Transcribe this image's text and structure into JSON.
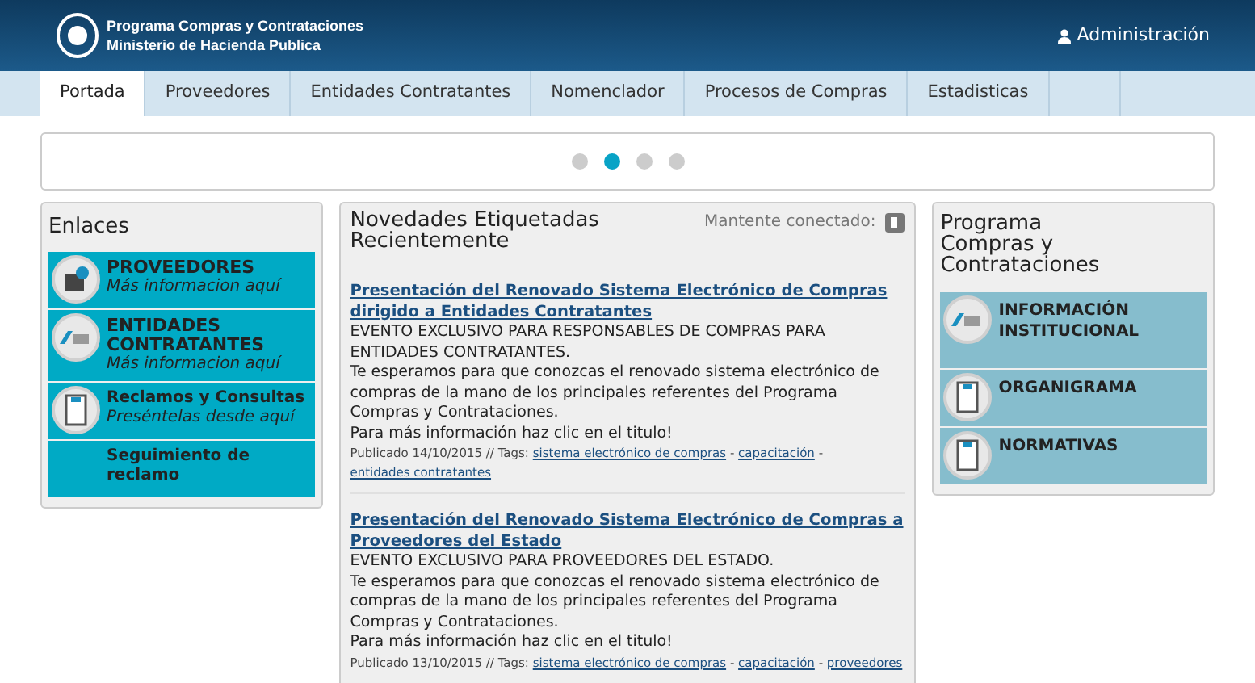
{
  "header": {
    "title_lines": [
      "Programa Compras y Contrataciones",
      "Ministerio de Hacienda Publica"
    ],
    "admin_link": "Administración"
  },
  "tabs": [
    {
      "label": "Portada",
      "selected": true
    },
    {
      "label": "Proveedores",
      "selected": false
    },
    {
      "label": "Entidades Contratantes",
      "selected": false
    },
    {
      "label": "Nomenclador",
      "selected": false
    },
    {
      "label": "Procesos de Compras",
      "selected": false
    },
    {
      "label": "Estadisticas",
      "selected": false
    }
  ],
  "carousel": {
    "dots": [
      {
        "selected": false
      },
      {
        "selected": true
      },
      {
        "selected": false
      },
      {
        "selected": false
      }
    ]
  },
  "enlaces": {
    "title": "Enlaces",
    "items": [
      {
        "title": "PROVEEDORES",
        "subtitle": "Más informacion aquí"
      },
      {
        "title": "ENTIDADES CONTRATANTES",
        "subtitle": "Más informacion aquí"
      },
      {
        "title": "Reclamos y Consultas",
        "subtitle": "Preséntelas desde aquí"
      },
      {
        "title": "Seguimiento de reclamo"
      }
    ]
  },
  "news": {
    "title": "Novedades Etiquetadas Recientemente",
    "keep_connected": "Mantente conectado:",
    "posts": [
      {
        "title": "Presentación del Renovado Sistema Electrónico de Compras dirigido a Entidades Contratantes",
        "paragraphs": [
          "EVENTO EXCLUSIVO PARA RESPONSABLES DE COMPRAS PARA ENTIDADES CONTRATANTES.",
          "Te esperamos para que conozcas el renovado sistema electrónico de compras de la mano de los principales referentes del Programa Compras y Contrataciones.",
          "Para más información haz clic en el titulo!"
        ],
        "published": "Publicado 14/10/2015 // Tags:",
        "tags": [
          "sistema electrónico de compras",
          "capacitación",
          "entidades contratantes"
        ]
      },
      {
        "title": "Presentación del Renovado Sistema Electrónico de Compras a Proveedores del Estado",
        "paragraphs": [
          "EVENTO EXCLUSIVO PARA PROVEEDORES DEL ESTADO.",
          "Te esperamos para que conozcas el renovado sistema electrónico de compras de la mano de los principales referentes del Programa Compras y Contrataciones.",
          "Para más información haz clic en el titulo!"
        ],
        "published": "Publicado 13/10/2015 // Tags:",
        "tags": [
          "sistema electrónico de compras",
          "capacitación",
          "proveedores"
        ]
      }
    ],
    "tag_separator": "-"
  },
  "programa": {
    "title": "Programa Compras y Contrataciones",
    "items": [
      {
        "title": "INFORMACIÓN INSTITUCIONAL"
      },
      {
        "title": "ORGANIGRAMA"
      },
      {
        "title": "NORMATIVAS"
      }
    ]
  }
}
